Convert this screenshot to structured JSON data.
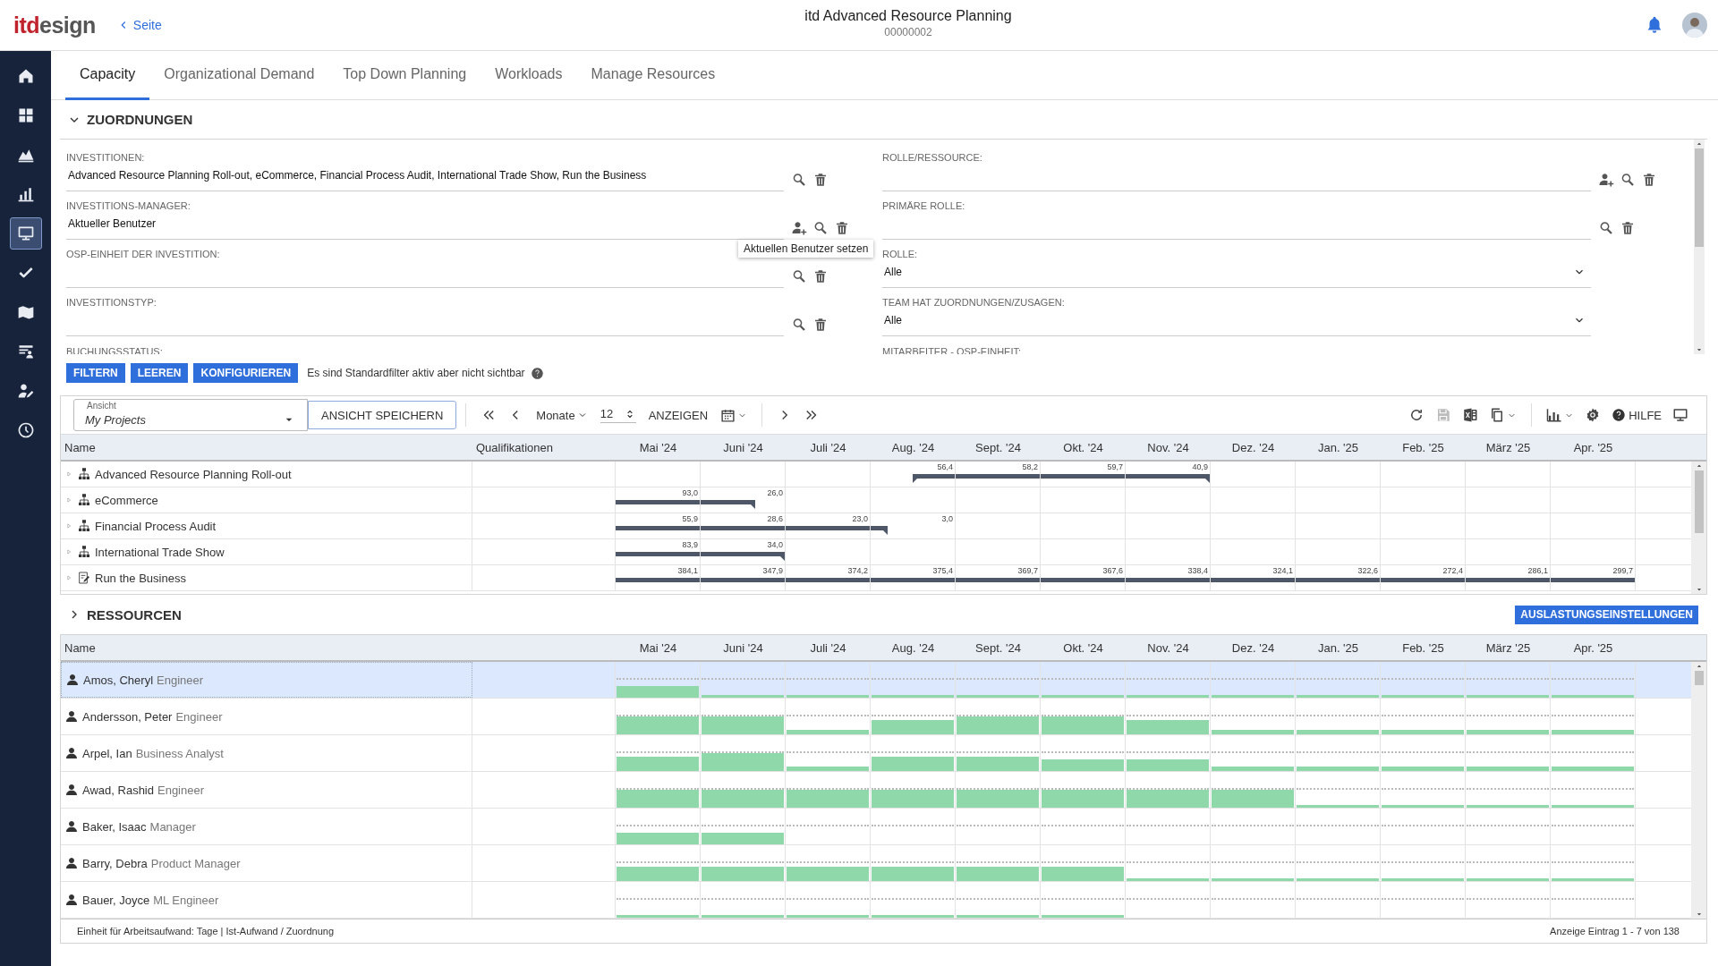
{
  "header": {
    "logo": {
      "accent": "itd",
      "rest": "esign"
    },
    "back_link": "Seite",
    "title": "itd Advanced Resource Planning",
    "subtitle": "00000002"
  },
  "sidebar": {
    "items": [
      {
        "kind": "home",
        "selected": false
      },
      {
        "kind": "grid",
        "selected": false
      },
      {
        "kind": "area",
        "selected": false
      },
      {
        "kind": "bars",
        "selected": false
      },
      {
        "kind": "monitor",
        "selected": true
      },
      {
        "kind": "check",
        "selected": false
      },
      {
        "kind": "map",
        "selected": false
      },
      {
        "kind": "list_person",
        "selected": false
      },
      {
        "kind": "person_edit",
        "selected": false
      },
      {
        "kind": "clock",
        "selected": false
      }
    ]
  },
  "tabs": [
    {
      "label": "Capacity",
      "selected": true
    },
    {
      "label": "Organizational Demand",
      "selected": false
    },
    {
      "label": "Top Down Planning",
      "selected": false
    },
    {
      "label": "Workloads",
      "selected": false
    },
    {
      "label": "Manage Resources",
      "selected": false
    }
  ],
  "assignments": {
    "title": "ZUORDNUNGEN",
    "expanded": true,
    "fields_left": [
      {
        "kind": "lookup",
        "label": "INVESTITIONEN:",
        "value": "Advanced Resource Planning Roll-out, eCommerce, Financial Process Audit, International Trade Show, Run the Business",
        "actions": [
          {
            "kind": "search"
          },
          {
            "kind": "delete"
          }
        ]
      },
      {
        "kind": "lookup",
        "label": "INVESTITIONS-MANAGER:",
        "value": "Aktueller Benutzer",
        "actions": [
          {
            "kind": "person_add"
          },
          {
            "kind": "search"
          },
          {
            "kind": "delete"
          }
        ]
      },
      {
        "kind": "lookup",
        "label": "OSP-EINHEIT DER INVESTITION:",
        "actions": [
          {
            "kind": "search"
          },
          {
            "kind": "delete"
          }
        ]
      },
      {
        "kind": "lookup",
        "label": "INVESTITIONSTYP:",
        "actions": [
          {
            "kind": "search"
          },
          {
            "kind": "delete"
          }
        ]
      },
      {
        "kind": "label",
        "label": "BUCHUNGSSTATUS:"
      }
    ],
    "fields_right": [
      {
        "kind": "lookup",
        "label": "ROLLE/RESSOURCE:",
        "actions": [
          {
            "kind": "person_add"
          },
          {
            "kind": "search"
          },
          {
            "kind": "delete"
          }
        ]
      },
      {
        "kind": "lookup",
        "label": "PRIMÄRE ROLLE:",
        "actions": [
          {
            "kind": "search"
          },
          {
            "kind": "delete"
          }
        ]
      },
      {
        "kind": "select",
        "label": "ROLLE:",
        "value": "Alle"
      },
      {
        "kind": "select",
        "label": "TEAM HAT ZUORDNUNGEN/ZUSAGEN:",
        "value": "Alle"
      },
      {
        "kind": "label",
        "label": "MITARBEITER - OSP-EINHEIT:"
      }
    ],
    "tooltip": "Aktuellen Benutzer setzen",
    "buttons": [
      "FILTERN",
      "LEEREN",
      "KONFIGURIEREN"
    ],
    "note": "Es sind Standardfilter aktiv aber nicht sichtbar"
  },
  "planning": {
    "view": {
      "legend": "Ansicht",
      "value": "My Projects"
    },
    "save_view": "ANSICHT SPEICHERN",
    "unit": "Monate",
    "count": "12",
    "show": "ANZEIGEN",
    "tools": [
      {
        "kind": "refresh",
        "disabled": false,
        "dropdown": false
      },
      {
        "kind": "save",
        "disabled": true,
        "dropdown": false
      },
      {
        "kind": "excel",
        "disabled": false,
        "dropdown": false
      },
      {
        "kind": "copy",
        "disabled": false,
        "dropdown": true
      },
      {
        "kind": "chart",
        "disabled": false,
        "dropdown": true
      },
      {
        "kind": "gear",
        "disabled": false,
        "dropdown": false
      },
      {
        "kind": "help",
        "disabled": false,
        "dropdown": false,
        "label": "HILFE"
      },
      {
        "kind": "monitor",
        "disabled": false,
        "dropdown": false
      }
    ],
    "columns": [
      "Name",
      "Qualifikationen"
    ],
    "months": [
      "Mai '24",
      "Juni '24",
      "Juli '24",
      "Aug. '24",
      "Sept. '24",
      "Okt. '24",
      "Nov. '24",
      "Dez. '24",
      "Jan. '25",
      "Feb. '25",
      "März '25",
      "Apr. '25"
    ],
    "rows": [
      {
        "name": "Advanced Resource Planning Roll-out",
        "kind": "hierarchy",
        "cells": [
          {
            "kind": "none"
          },
          {
            "kind": "none"
          },
          {
            "kind": "none"
          },
          {
            "label": "56,4",
            "kind": "start",
            "level": 0.5
          },
          {
            "label": "58,2",
            "kind": "full"
          },
          {
            "label": "59,7",
            "kind": "full"
          },
          {
            "label": "40,9",
            "kind": "end",
            "level": 1
          },
          {
            "kind": "none"
          },
          {
            "kind": "none"
          },
          {
            "kind": "none"
          },
          {
            "kind": "none"
          },
          {
            "kind": "none"
          }
        ]
      },
      {
        "name": "eCommerce",
        "kind": "hierarchy",
        "cells": [
          {
            "label": "93,0",
            "kind": "full"
          },
          {
            "label": "26,0",
            "kind": "end",
            "level": 0.65
          },
          {
            "kind": "none"
          },
          {
            "kind": "none"
          },
          {
            "kind": "none"
          },
          {
            "kind": "none"
          },
          {
            "kind": "none"
          },
          {
            "kind": "none"
          },
          {
            "kind": "none"
          },
          {
            "kind": "none"
          },
          {
            "kind": "none"
          },
          {
            "kind": "none"
          }
        ]
      },
      {
        "name": "Financial Process Audit",
        "kind": "hierarchy",
        "cells": [
          {
            "label": "55,9",
            "kind": "full"
          },
          {
            "label": "28,6",
            "kind": "full"
          },
          {
            "label": "23,0",
            "kind": "full"
          },
          {
            "label": "3,0",
            "kind": "end",
            "level": 0.2
          },
          {
            "kind": "none"
          },
          {
            "kind": "none"
          },
          {
            "kind": "none"
          },
          {
            "kind": "none"
          },
          {
            "kind": "none"
          },
          {
            "kind": "none"
          },
          {
            "kind": "none"
          },
          {
            "kind": "none"
          }
        ]
      },
      {
        "name": "International Trade Show",
        "kind": "hierarchy",
        "cells": [
          {
            "label": "83,9",
            "kind": "full"
          },
          {
            "label": "34,0",
            "kind": "end",
            "level": 1
          },
          {
            "kind": "none"
          },
          {
            "kind": "none"
          },
          {
            "kind": "none"
          },
          {
            "kind": "none"
          },
          {
            "kind": "none"
          },
          {
            "kind": "none"
          },
          {
            "kind": "none"
          },
          {
            "kind": "none"
          },
          {
            "kind": "none"
          },
          {
            "kind": "none"
          }
        ]
      },
      {
        "name": "Run the Business",
        "kind": "document",
        "cells": [
          {
            "label": "384,1",
            "kind": "full"
          },
          {
            "label": "347,9",
            "kind": "full"
          },
          {
            "label": "374,2",
            "kind": "full"
          },
          {
            "label": "375,4",
            "kind": "full"
          },
          {
            "label": "369,7",
            "kind": "full"
          },
          {
            "label": "367,6",
            "kind": "full"
          },
          {
            "label": "338,4",
            "kind": "full"
          },
          {
            "label": "324,1",
            "kind": "full"
          },
          {
            "label": "322,6",
            "kind": "full"
          },
          {
            "label": "272,4",
            "kind": "full"
          },
          {
            "label": "286,1",
            "kind": "full"
          },
          {
            "label": "299,7",
            "kind": "full"
          }
        ]
      }
    ]
  },
  "resources": {
    "title": "RESSOURCEN",
    "expanded": false,
    "settings_button": "AUSLASTUNGSEINSTELLUNGEN",
    "columns": [
      "Name"
    ],
    "months": [
      "Mai '24",
      "Juni '24",
      "Juli '24",
      "Aug. '24",
      "Sept. '24",
      "Okt. '24",
      "Nov. '24",
      "Dez. '24",
      "Jan. '25",
      "Feb. '25",
      "März '25",
      "Apr. '25"
    ],
    "rows": [
      {
        "name": "Amos, Cheryl",
        "role": "Engineer",
        "selected": true,
        "load": [
          {
            "kind": "medium"
          },
          {
            "kind": "minimal"
          },
          {
            "kind": "minimal"
          },
          {
            "kind": "minimal"
          },
          {
            "kind": "minimal"
          },
          {
            "kind": "minimal"
          },
          {
            "kind": "minimal"
          },
          {
            "kind": "minimal"
          },
          {
            "kind": "minimal"
          },
          {
            "kind": "minimal"
          },
          {
            "kind": "minimal"
          },
          {
            "kind": "minimal"
          }
        ]
      },
      {
        "name": "Andersson, Peter",
        "role": "Engineer",
        "selected": false,
        "load": [
          {
            "kind": "full"
          },
          {
            "kind": "full"
          },
          {
            "kind": "low"
          },
          {
            "kind": "high"
          },
          {
            "kind": "full"
          },
          {
            "kind": "full"
          },
          {
            "kind": "high"
          },
          {
            "kind": "low"
          },
          {
            "kind": "low"
          },
          {
            "kind": "low"
          },
          {
            "kind": "low"
          },
          {
            "kind": "low"
          }
        ]
      },
      {
        "name": "Arpel, Ian",
        "role": "Business Analyst",
        "selected": false,
        "load": [
          {
            "kind": "high"
          },
          {
            "kind": "full"
          },
          {
            "kind": "low"
          },
          {
            "kind": "high"
          },
          {
            "kind": "high"
          },
          {
            "kind": "medium"
          },
          {
            "kind": "medium"
          },
          {
            "kind": "low"
          },
          {
            "kind": "low"
          },
          {
            "kind": "low"
          },
          {
            "kind": "low"
          },
          {
            "kind": "low"
          }
        ]
      },
      {
        "name": "Awad, Rashid",
        "role": "Engineer",
        "selected": false,
        "load": [
          {
            "kind": "full"
          },
          {
            "kind": "full"
          },
          {
            "kind": "full"
          },
          {
            "kind": "full"
          },
          {
            "kind": "full"
          },
          {
            "kind": "full"
          },
          {
            "kind": "full"
          },
          {
            "kind": "full"
          },
          {
            "kind": "minimal"
          },
          {
            "kind": "minimal"
          },
          {
            "kind": "minimal"
          },
          {
            "kind": "minimal"
          }
        ]
      },
      {
        "name": "Baker, Isaac",
        "role": "Manager",
        "selected": false,
        "load": [
          {
            "kind": "medium"
          },
          {
            "kind": "medium"
          },
          {
            "kind": "none"
          },
          {
            "kind": "none"
          },
          {
            "kind": "none"
          },
          {
            "kind": "none"
          },
          {
            "kind": "none"
          },
          {
            "kind": "none"
          },
          {
            "kind": "none"
          },
          {
            "kind": "none"
          },
          {
            "kind": "none"
          },
          {
            "kind": "none"
          }
        ]
      },
      {
        "name": "Barry, Debra",
        "role": "Product Manager",
        "selected": false,
        "load": [
          {
            "kind": "high"
          },
          {
            "kind": "high"
          },
          {
            "kind": "high"
          },
          {
            "kind": "high"
          },
          {
            "kind": "high"
          },
          {
            "kind": "high"
          },
          {
            "kind": "minimal"
          },
          {
            "kind": "minimal"
          },
          {
            "kind": "minimal"
          },
          {
            "kind": "minimal"
          },
          {
            "kind": "minimal"
          },
          {
            "kind": "minimal"
          }
        ]
      },
      {
        "name": "Bauer, Joyce",
        "role": "ML Engineer",
        "selected": false,
        "load": [
          {
            "kind": "minimal"
          },
          {
            "kind": "minimal"
          },
          {
            "kind": "minimal"
          },
          {
            "kind": "minimal"
          },
          {
            "kind": "minimal"
          },
          {
            "kind": "minimal"
          },
          {
            "kind": "none"
          },
          {
            "kind": "none"
          },
          {
            "kind": "none"
          },
          {
            "kind": "none"
          },
          {
            "kind": "none"
          },
          {
            "kind": "none"
          }
        ]
      }
    ],
    "footer_left": "Einheit für Arbeitsaufwand: Tage | Ist-Aufwand / Zuordnung",
    "footer_right": "Anzeige Eintrag 1 - 7 von 138"
  }
}
